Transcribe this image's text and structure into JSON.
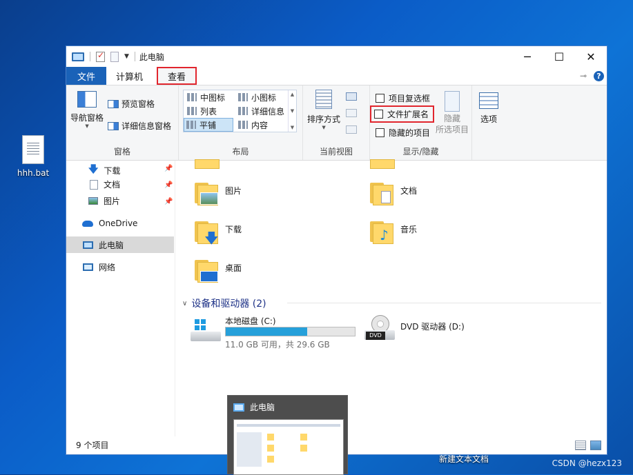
{
  "desktop": {
    "icon_label": "hhh.bat",
    "bottom_label": "新建文本文档",
    "watermark": "CSDN @hezx123"
  },
  "window": {
    "title": "此电脑",
    "tabs": {
      "file": "文件",
      "computer": "计算机",
      "view": "查看"
    }
  },
  "ribbon": {
    "pane": {
      "nav_pane": "导航窗格",
      "preview_pane": "预览窗格",
      "details_pane": "详细信息窗格",
      "label": "窗格"
    },
    "layout": {
      "medium_icons": "中图标",
      "small_icons": "小图标",
      "list": "列表",
      "details": "详细信息",
      "tiles": "平铺",
      "content": "内容",
      "label": "布局"
    },
    "current_view": {
      "sort_by": "排序方式",
      "label": "当前视图"
    },
    "show_hide": {
      "item_checkboxes": "项目复选框",
      "file_extensions": "文件扩展名",
      "hidden_items": "隐藏的项目",
      "hide_line1": "隐藏",
      "hide_line2": "所选项目",
      "label": "显示/隐藏"
    },
    "options": "选项"
  },
  "nav": {
    "items": [
      "下载",
      "文档",
      "图片",
      "OneDrive",
      "此电脑",
      "网络"
    ]
  },
  "main": {
    "folders": [
      "图片",
      "文档",
      "下载",
      "音乐",
      "桌面"
    ],
    "devices_header": "设备和驱动器 (2)",
    "drives": [
      {
        "name": "本地磁盘 (C:)",
        "free": "11.0 GB 可用，共 29.6 GB",
        "used_fraction": 0.63
      },
      {
        "name": "DVD 驱动器 (D:)"
      }
    ]
  },
  "status": {
    "count": "9 个项目"
  },
  "thumbnail": {
    "title": "此电脑"
  },
  "colors": {
    "accent": "#1a62b8",
    "highlight_border": "#e1252d",
    "drive_bar": "#26a0da"
  }
}
